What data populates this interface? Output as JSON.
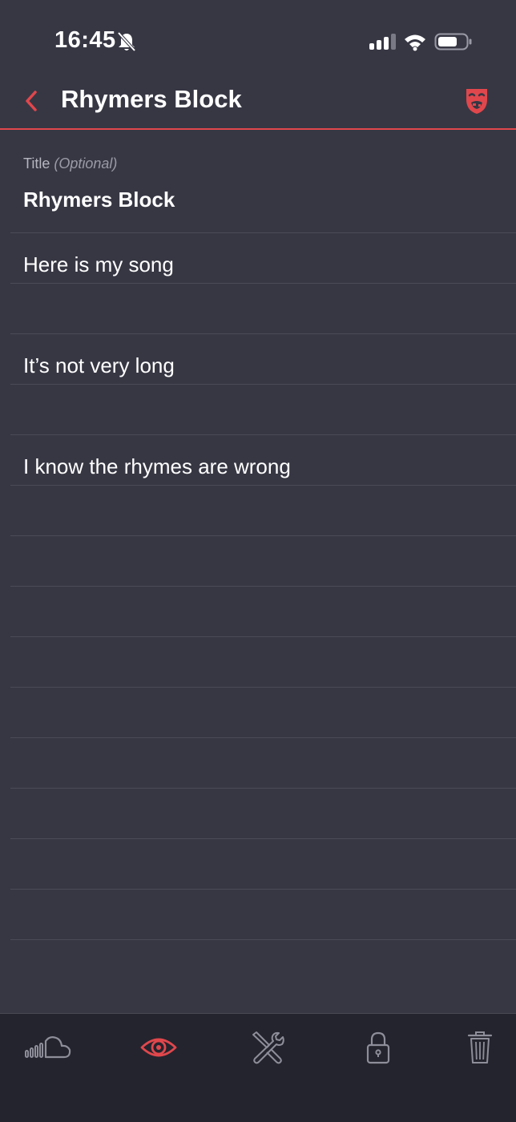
{
  "status_bar": {
    "time": "16:45"
  },
  "nav": {
    "title": "Rhymers Block",
    "accent_color": "#e0474c"
  },
  "song": {
    "title_label": "Title",
    "title_optional": "(Optional)",
    "title_value": "Rhymers Block",
    "lines": [
      "Here is my song",
      "",
      "It’s not very long",
      "",
      "I know the rhymes are wrong",
      "",
      "",
      "",
      "",
      "",
      "",
      "",
      "",
      "",
      ""
    ]
  },
  "toolbar": {
    "items": [
      {
        "icon": "soundcloud-icon",
        "active": false
      },
      {
        "icon": "eye-icon",
        "active": true
      },
      {
        "icon": "tools-icon",
        "active": false
      },
      {
        "icon": "lock-icon",
        "active": false
      },
      {
        "icon": "trash-icon",
        "active": false
      }
    ]
  }
}
